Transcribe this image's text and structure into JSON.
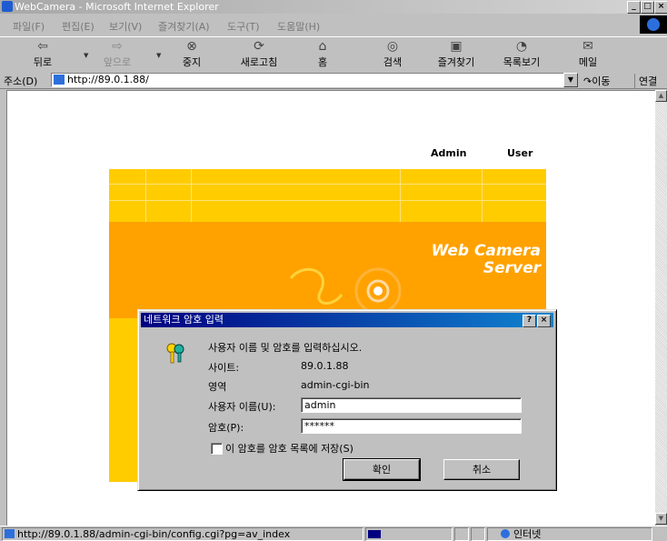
{
  "window": {
    "title": "WebCamera - Microsoft Internet Explorer"
  },
  "menu": [
    "파일(F)",
    "편집(E)",
    "보기(V)",
    "즐겨찾기(A)",
    "도구(T)",
    "도움말(H)"
  ],
  "toolbar": {
    "back": "뒤로",
    "forward": "앞으로",
    "stop": "중지",
    "refresh": "새로고침",
    "home": "홈",
    "search": "검색",
    "favorites": "즐겨찾기",
    "history": "목록보기",
    "mail": "메일"
  },
  "address": {
    "label": "주소(D)",
    "url": "http://89.0.1.88/",
    "go": "이동",
    "links": "연결"
  },
  "page": {
    "nav_admin": "Admin",
    "nav_user": "User",
    "banner_line1": "Web Camera",
    "banner_line2": "Server"
  },
  "dialog": {
    "title": "네트워크 암호 입력",
    "help": "?",
    "close": "×",
    "prompt": "사용자 이름 및 암호를 입력하십시오.",
    "site_label": "사이트:",
    "site_value": "89.0.1.88",
    "realm_label": "영역",
    "realm_value": "admin-cgi-bin",
    "username_label": "사용자 이름(U):",
    "username_value": "admin",
    "password_label": "암호(P):",
    "password_value": "******",
    "save_label": "이 암호를 암호 목록에 저장(S)",
    "ok_label": "확인",
    "cancel_label": "취소"
  },
  "status": {
    "url": "http://89.0.1.88/admin-cgi-bin/config.cgi?pg=av_index",
    "zone": "인터넷"
  }
}
